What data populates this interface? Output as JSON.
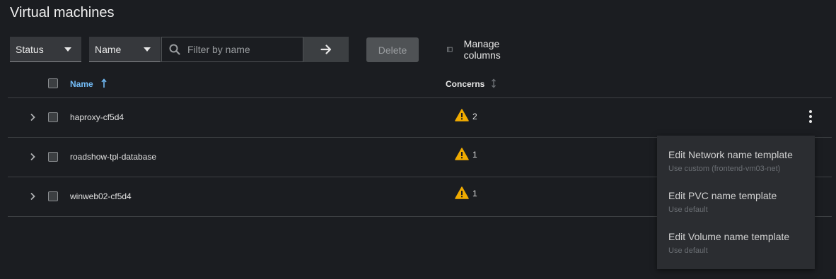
{
  "page": {
    "title": "Virtual machines"
  },
  "toolbar": {
    "status_select": "Status",
    "name_select": "Name",
    "filter_placeholder": "Filter by name",
    "delete_label": "Delete",
    "manage_columns_label": "Manage columns"
  },
  "table": {
    "columns": {
      "name": "Name",
      "concerns": "Concerns"
    },
    "sort": {
      "column": "Name",
      "direction": "ascending"
    },
    "rows": [
      {
        "name": "haproxy-cf5d4",
        "concerns": "2"
      },
      {
        "name": "roadshow-tpl-database",
        "concerns": "1"
      },
      {
        "name": "winweb02-cf5d4",
        "concerns": "1"
      }
    ]
  },
  "menu": {
    "items": [
      {
        "label": "Edit Network name template",
        "description": "Use custom (frontend-vm03-net)"
      },
      {
        "label": "Edit PVC name template",
        "description": "Use default"
      },
      {
        "label": "Edit Volume name template",
        "description": "Use default"
      }
    ]
  },
  "icons": {
    "search": "search-icon",
    "go": "arrow-right-icon",
    "manage_columns": "columns-icon",
    "sort_asc": "arrow-up-icon",
    "sort_unsorted": "sort-icon",
    "expand": "chevron-right-icon",
    "warning": "warning-icon",
    "kebab": "kebab-icon"
  },
  "colors": {
    "background": "#1b1d21",
    "accent": "#73bcf7",
    "warning": "#f0ab00",
    "menu_bg": "#2b2d31"
  }
}
